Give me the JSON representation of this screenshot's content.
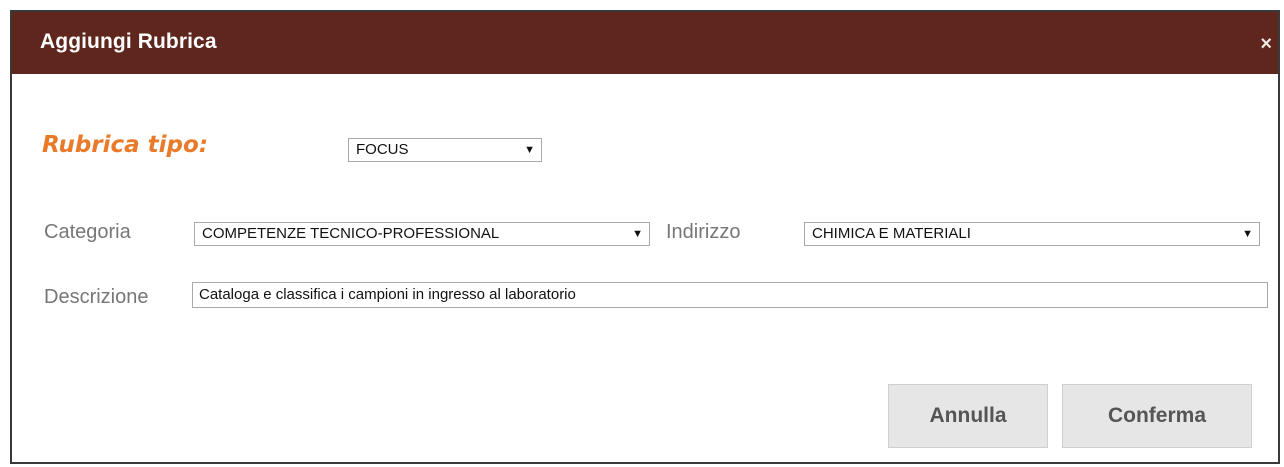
{
  "dialog": {
    "title": "Aggiungi Rubrica",
    "close_glyph": "×"
  },
  "form": {
    "type_label": "Rubrica tipo:",
    "type_value": "FOCUS",
    "category_label": "Categoria",
    "category_value": "COMPETENZE TECNICO-PROFESSIONAL",
    "address_label": "Indirizzo",
    "address_value": "CHIMICA E MATERIALI",
    "description_label": "Descrizione",
    "description_value": "Cataloga e classifica i campioni in ingresso al laboratorio"
  },
  "buttons": {
    "cancel": "Annulla",
    "confirm": "Conferma"
  },
  "icons": {
    "close": "close-icon",
    "dropdown": "triangle-down-icon"
  },
  "colors": {
    "titlebar": "#5e261c",
    "accent_label": "#e87a2a",
    "button_bg": "#e6e6e6"
  }
}
